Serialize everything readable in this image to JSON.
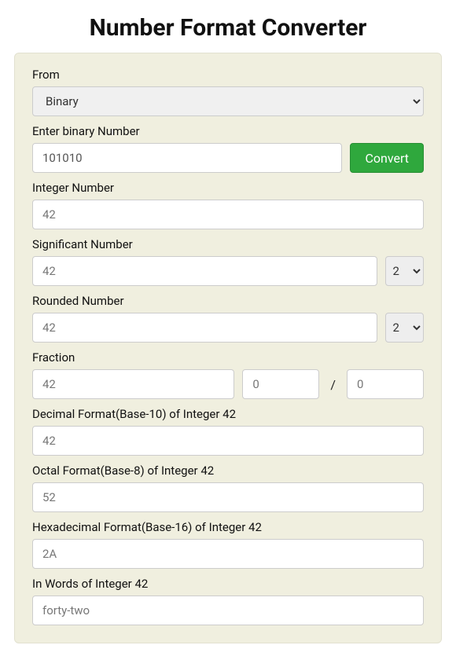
{
  "title": "Number Format Converter",
  "from": {
    "label": "From",
    "selected": "Binary"
  },
  "input": {
    "label": "Enter binary Number",
    "value": "101010",
    "button": "Convert"
  },
  "integer": {
    "label": "Integer Number",
    "value": "42"
  },
  "significant": {
    "label": "Significant Number",
    "value": "42",
    "precision": "2"
  },
  "rounded": {
    "label": "Rounded Number",
    "value": "42",
    "precision": "2"
  },
  "fraction": {
    "label": "Fraction",
    "whole": "42",
    "numerator": "0",
    "slash": "/",
    "denominator": "0"
  },
  "decimal": {
    "label": "Decimal Format(Base-10) of Integer 42",
    "value": "42"
  },
  "octal": {
    "label": "Octal Format(Base-8) of Integer 42",
    "value": "52"
  },
  "hex": {
    "label": "Hexadecimal Format(Base-16) of Integer 42",
    "value": "2A"
  },
  "words": {
    "label": "In Words of Integer 42",
    "value": "forty-two"
  }
}
